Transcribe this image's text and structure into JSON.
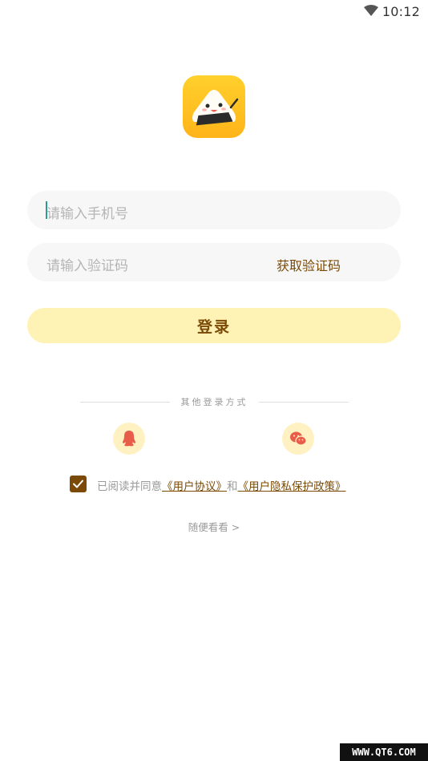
{
  "status_bar": {
    "time": "10:12",
    "icons": [
      "wifi-icon"
    ]
  },
  "logo": {
    "icon": "rice-ball-mascot-icon",
    "bg_color": "#ffc41f"
  },
  "phone_input": {
    "placeholder": "请输入手机号"
  },
  "code_input": {
    "placeholder": "请输入验证码",
    "get_code_label": "获取验证码"
  },
  "login_button": {
    "label": "登录",
    "bg_color": "#fff2b5",
    "text_color": "#7a4a06"
  },
  "other_login": {
    "title": "其他登录方式",
    "methods": [
      {
        "icon": "qq-icon"
      },
      {
        "icon": "wechat-icon"
      }
    ]
  },
  "agreement": {
    "checked": true,
    "prefix": "已阅读并同意",
    "user_agreement": "《用户协议》",
    "and": "和",
    "privacy_policy": "《用户隐私保护政策》"
  },
  "browse_link": "随便看看 >",
  "watermark": "WWW.QT6.COM"
}
